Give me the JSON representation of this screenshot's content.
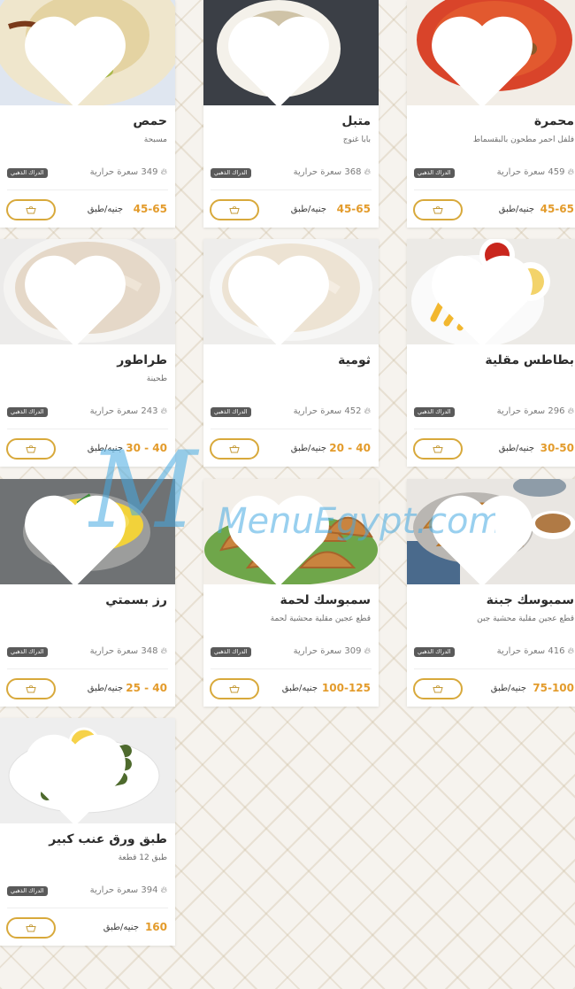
{
  "badge_label": "الدراك الذهبي",
  "price_unit": "جنيه/طبق",
  "calorie_suffix": "سعرة حرارية",
  "watermark_text": "MenuEgypt.com",
  "items": [
    {
      "name": "حمص",
      "description": "مسبحة",
      "calories": "349",
      "price": "45-65"
    },
    {
      "name": "متبل",
      "description": "بابا غنوج",
      "calories": "368",
      "price": "45-65"
    },
    {
      "name": "محمرة",
      "description": "فلفل احمر مطحون بالبقسماط",
      "calories": "459",
      "price": "45-65"
    },
    {
      "name": "طراطور",
      "description": "طحينة",
      "calories": "243",
      "price": "30 - 40"
    },
    {
      "name": "ثومية",
      "description": "",
      "calories": "452",
      "price": "20 - 40"
    },
    {
      "name": "بطاطس مقلية",
      "description": "",
      "calories": "296",
      "price": "30-50"
    },
    {
      "name": "رز بسمتي",
      "description": "",
      "calories": "348",
      "price": "25 - 40"
    },
    {
      "name": "سمبوسك لحمة",
      "description": "قطع عجين مقلية محشية لحمة",
      "calories": "309",
      "price": "100-125"
    },
    {
      "name": "سمبوسك جبنة",
      "description": "قطع عجين مقلية محشية جبن",
      "calories": "416",
      "price": "75-100"
    },
    {
      "name": "طبق ورق عنب كبير",
      "description": "طبق 12 قطعة",
      "calories": "394",
      "price": "160"
    }
  ]
}
